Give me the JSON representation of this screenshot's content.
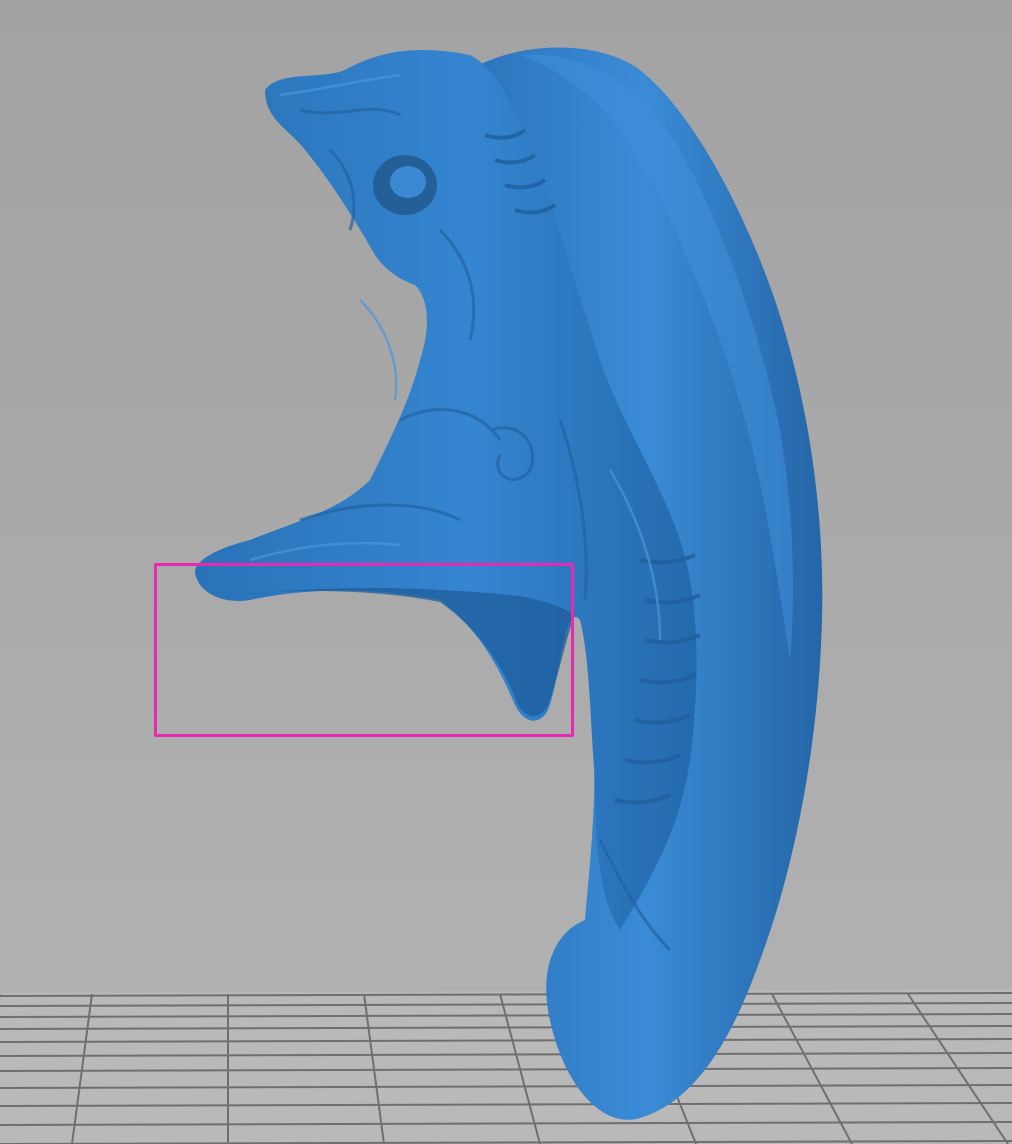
{
  "viewport": {
    "background_top": "#a3a3a3",
    "background_bottom": "#b4b4b4"
  },
  "build_plate": {
    "color": "#b8b8b8",
    "grid_color": "#6f6f6f"
  },
  "model": {
    "color": "#2f7dc6",
    "shadow_color": "#1d5c99",
    "highlight_color": "#4d97dc"
  },
  "selection": {
    "color": "#e82ab0"
  }
}
